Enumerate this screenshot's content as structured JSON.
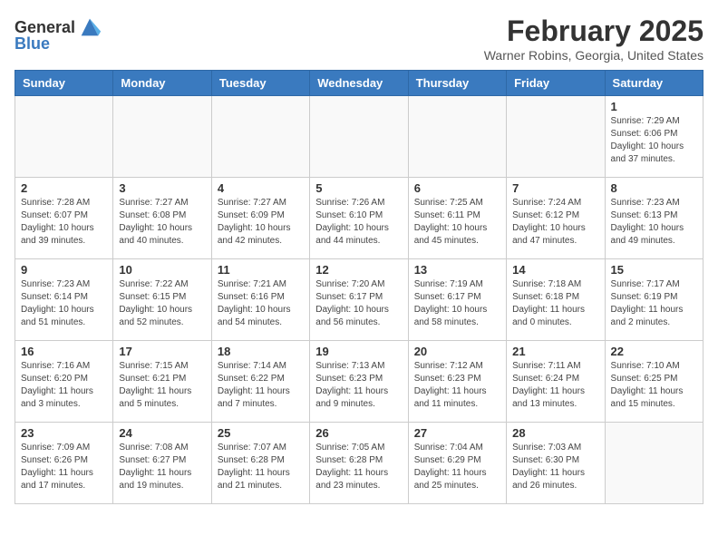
{
  "header": {
    "logo_general": "General",
    "logo_blue": "Blue",
    "month_title": "February 2025",
    "location": "Warner Robins, Georgia, United States"
  },
  "weekdays": [
    "Sunday",
    "Monday",
    "Tuesday",
    "Wednesday",
    "Thursday",
    "Friday",
    "Saturday"
  ],
  "weeks": [
    [
      {
        "day": "",
        "info": ""
      },
      {
        "day": "",
        "info": ""
      },
      {
        "day": "",
        "info": ""
      },
      {
        "day": "",
        "info": ""
      },
      {
        "day": "",
        "info": ""
      },
      {
        "day": "",
        "info": ""
      },
      {
        "day": "1",
        "info": "Sunrise: 7:29 AM\nSunset: 6:06 PM\nDaylight: 10 hours\nand 37 minutes."
      }
    ],
    [
      {
        "day": "2",
        "info": "Sunrise: 7:28 AM\nSunset: 6:07 PM\nDaylight: 10 hours\nand 39 minutes."
      },
      {
        "day": "3",
        "info": "Sunrise: 7:27 AM\nSunset: 6:08 PM\nDaylight: 10 hours\nand 40 minutes."
      },
      {
        "day": "4",
        "info": "Sunrise: 7:27 AM\nSunset: 6:09 PM\nDaylight: 10 hours\nand 42 minutes."
      },
      {
        "day": "5",
        "info": "Sunrise: 7:26 AM\nSunset: 6:10 PM\nDaylight: 10 hours\nand 44 minutes."
      },
      {
        "day": "6",
        "info": "Sunrise: 7:25 AM\nSunset: 6:11 PM\nDaylight: 10 hours\nand 45 minutes."
      },
      {
        "day": "7",
        "info": "Sunrise: 7:24 AM\nSunset: 6:12 PM\nDaylight: 10 hours\nand 47 minutes."
      },
      {
        "day": "8",
        "info": "Sunrise: 7:23 AM\nSunset: 6:13 PM\nDaylight: 10 hours\nand 49 minutes."
      }
    ],
    [
      {
        "day": "9",
        "info": "Sunrise: 7:23 AM\nSunset: 6:14 PM\nDaylight: 10 hours\nand 51 minutes."
      },
      {
        "day": "10",
        "info": "Sunrise: 7:22 AM\nSunset: 6:15 PM\nDaylight: 10 hours\nand 52 minutes."
      },
      {
        "day": "11",
        "info": "Sunrise: 7:21 AM\nSunset: 6:16 PM\nDaylight: 10 hours\nand 54 minutes."
      },
      {
        "day": "12",
        "info": "Sunrise: 7:20 AM\nSunset: 6:17 PM\nDaylight: 10 hours\nand 56 minutes."
      },
      {
        "day": "13",
        "info": "Sunrise: 7:19 AM\nSunset: 6:17 PM\nDaylight: 10 hours\nand 58 minutes."
      },
      {
        "day": "14",
        "info": "Sunrise: 7:18 AM\nSunset: 6:18 PM\nDaylight: 11 hours\nand 0 minutes."
      },
      {
        "day": "15",
        "info": "Sunrise: 7:17 AM\nSunset: 6:19 PM\nDaylight: 11 hours\nand 2 minutes."
      }
    ],
    [
      {
        "day": "16",
        "info": "Sunrise: 7:16 AM\nSunset: 6:20 PM\nDaylight: 11 hours\nand 3 minutes."
      },
      {
        "day": "17",
        "info": "Sunrise: 7:15 AM\nSunset: 6:21 PM\nDaylight: 11 hours\nand 5 minutes."
      },
      {
        "day": "18",
        "info": "Sunrise: 7:14 AM\nSunset: 6:22 PM\nDaylight: 11 hours\nand 7 minutes."
      },
      {
        "day": "19",
        "info": "Sunrise: 7:13 AM\nSunset: 6:23 PM\nDaylight: 11 hours\nand 9 minutes."
      },
      {
        "day": "20",
        "info": "Sunrise: 7:12 AM\nSunset: 6:23 PM\nDaylight: 11 hours\nand 11 minutes."
      },
      {
        "day": "21",
        "info": "Sunrise: 7:11 AM\nSunset: 6:24 PM\nDaylight: 11 hours\nand 13 minutes."
      },
      {
        "day": "22",
        "info": "Sunrise: 7:10 AM\nSunset: 6:25 PM\nDaylight: 11 hours\nand 15 minutes."
      }
    ],
    [
      {
        "day": "23",
        "info": "Sunrise: 7:09 AM\nSunset: 6:26 PM\nDaylight: 11 hours\nand 17 minutes."
      },
      {
        "day": "24",
        "info": "Sunrise: 7:08 AM\nSunset: 6:27 PM\nDaylight: 11 hours\nand 19 minutes."
      },
      {
        "day": "25",
        "info": "Sunrise: 7:07 AM\nSunset: 6:28 PM\nDaylight: 11 hours\nand 21 minutes."
      },
      {
        "day": "26",
        "info": "Sunrise: 7:05 AM\nSunset: 6:28 PM\nDaylight: 11 hours\nand 23 minutes."
      },
      {
        "day": "27",
        "info": "Sunrise: 7:04 AM\nSunset: 6:29 PM\nDaylight: 11 hours\nand 25 minutes."
      },
      {
        "day": "28",
        "info": "Sunrise: 7:03 AM\nSunset: 6:30 PM\nDaylight: 11 hours\nand 26 minutes."
      },
      {
        "day": "",
        "info": ""
      }
    ]
  ]
}
